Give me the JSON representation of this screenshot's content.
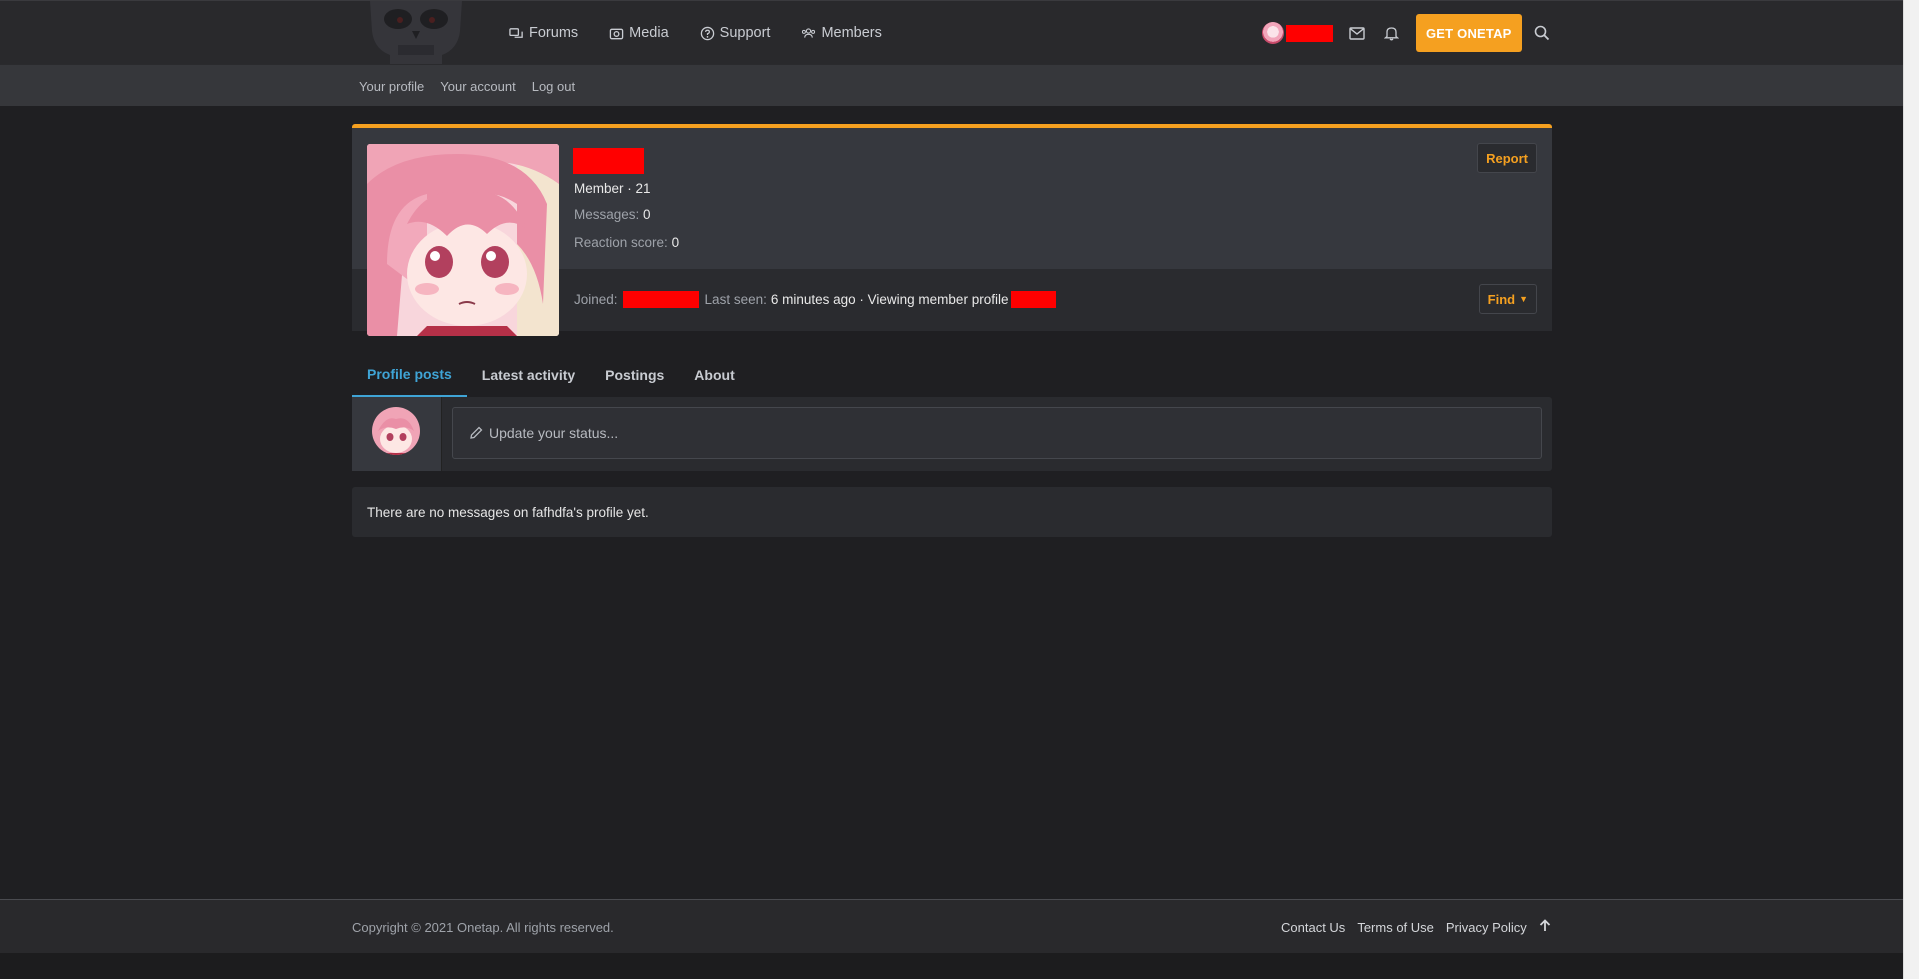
{
  "nav": {
    "items": [
      {
        "label": "Forums",
        "icon": "forums-icon"
      },
      {
        "label": "Media",
        "icon": "camera-icon"
      },
      {
        "label": "Support",
        "icon": "question-circle-icon"
      },
      {
        "label": "Members",
        "icon": "users-icon"
      }
    ],
    "get_button": "GET ONETAP"
  },
  "account_nav": {
    "profile": "Your profile",
    "account": "Your account",
    "logout": "Log out"
  },
  "profile": {
    "member_line": "Member · 21",
    "messages_label": "Messages:",
    "messages_value": "0",
    "reaction_label": "Reaction score:",
    "reaction_value": "0",
    "report": "Report",
    "joined_label": "Joined:",
    "last_seen_label": "Last seen:",
    "last_seen_value": "6 minutes ago · Viewing member profile",
    "find": "Find"
  },
  "tabs": [
    "Profile posts",
    "Latest activity",
    "Postings",
    "About"
  ],
  "status_placeholder": "Update your status...",
  "empty_message": "There are no messages on fafhdfa's profile yet.",
  "footer": {
    "copyright": "Copyright © 2021 Onetap. All rights reserved.",
    "contact": "Contact Us",
    "terms": "Terms of Use",
    "privacy": "Privacy Policy"
  },
  "colors": {
    "accent": "#f5a020",
    "tab_active": "#3fa4d6",
    "redaction": "#ff0000"
  }
}
